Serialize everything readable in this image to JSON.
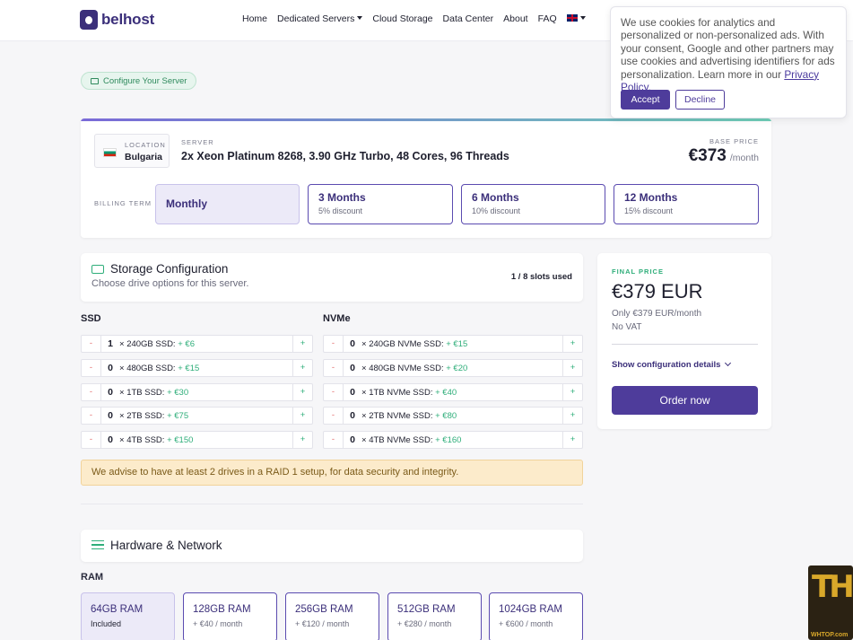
{
  "brand": {
    "logo_text": "belhost"
  },
  "nav": {
    "items": [
      "Home",
      "Dedicated Servers",
      "Cloud Storage",
      "Data Center",
      "About",
      "FAQ"
    ]
  },
  "cookie": {
    "text": "We use cookies for analytics and personalized or non-personalized ads. With your consent, Google and other partners may use cookies and advertising identifiers for ads personalization. Learn more in our ",
    "link": "Privacy Policy.",
    "accept": "Accept",
    "decline": "Decline"
  },
  "configure_pill": "Configure Your Server",
  "server": {
    "location_label": "LOCATION",
    "location": "Bulgaria",
    "server_label": "SERVER",
    "server_name": "2x Xeon Platinum 8268, 3.90 GHz Turbo, 48 Cores, 96 Threads",
    "base_price_label": "BASE PRICE",
    "base_price": "€373",
    "base_unit": "/month",
    "billing_label": "BILLING TERM",
    "terms": [
      {
        "name": "Monthly",
        "discount": ""
      },
      {
        "name": "3 Months",
        "discount": "5% discount"
      },
      {
        "name": "6 Months",
        "discount": "10% discount"
      },
      {
        "name": "12 Months",
        "discount": "15% discount"
      }
    ]
  },
  "storage": {
    "title": "Storage Configuration",
    "subtitle": "Choose drive options for this server.",
    "slots": "1 / 8 slots used",
    "ssd_title": "SSD",
    "nvme_title": "NVMe",
    "ssd": [
      {
        "qty": "1",
        "label": "240GB SSD:",
        "price": "+ €6"
      },
      {
        "qty": "0",
        "label": "480GB SSD:",
        "price": "+ €15"
      },
      {
        "qty": "0",
        "label": "1TB SSD:",
        "price": "+ €30"
      },
      {
        "qty": "0",
        "label": "2TB SSD:",
        "price": "+ €75"
      },
      {
        "qty": "0",
        "label": "4TB SSD:",
        "price": "+ €150"
      }
    ],
    "nvme": [
      {
        "qty": "0",
        "label": "240GB NVMe SSD:",
        "price": "+ €15"
      },
      {
        "qty": "0",
        "label": "480GB NVMe SSD:",
        "price": "+ €20"
      },
      {
        "qty": "0",
        "label": "1TB NVMe SSD:",
        "price": "+ €40"
      },
      {
        "qty": "0",
        "label": "2TB NVMe SSD:",
        "price": "+ €80"
      },
      {
        "qty": "0",
        "label": "4TB NVMe SSD:",
        "price": "+ €160"
      }
    ],
    "advise": "We advise to have at least 2 drives in a RAID 1 setup, for data security and integrity."
  },
  "hardware": {
    "title": "Hardware & Network",
    "ram_title": "RAM",
    "ram": [
      {
        "name": "64GB RAM",
        "price": "Included"
      },
      {
        "name": "128GB RAM",
        "price": "+ €40 / month"
      },
      {
        "name": "256GB RAM",
        "price": "+ €120 / month"
      },
      {
        "name": "512GB RAM",
        "price": "+ €280 / month"
      },
      {
        "name": "1024GB RAM",
        "price": "+ €600 / month"
      }
    ]
  },
  "final": {
    "label": "FINAL PRICE",
    "price": "€379 EUR",
    "monthly": "Only €379 EUR/month",
    "vat": "No VAT",
    "show": "Show configuration details",
    "order": "Order now"
  },
  "watermark": {
    "big": "TH",
    "small": "WHTOP.com"
  }
}
